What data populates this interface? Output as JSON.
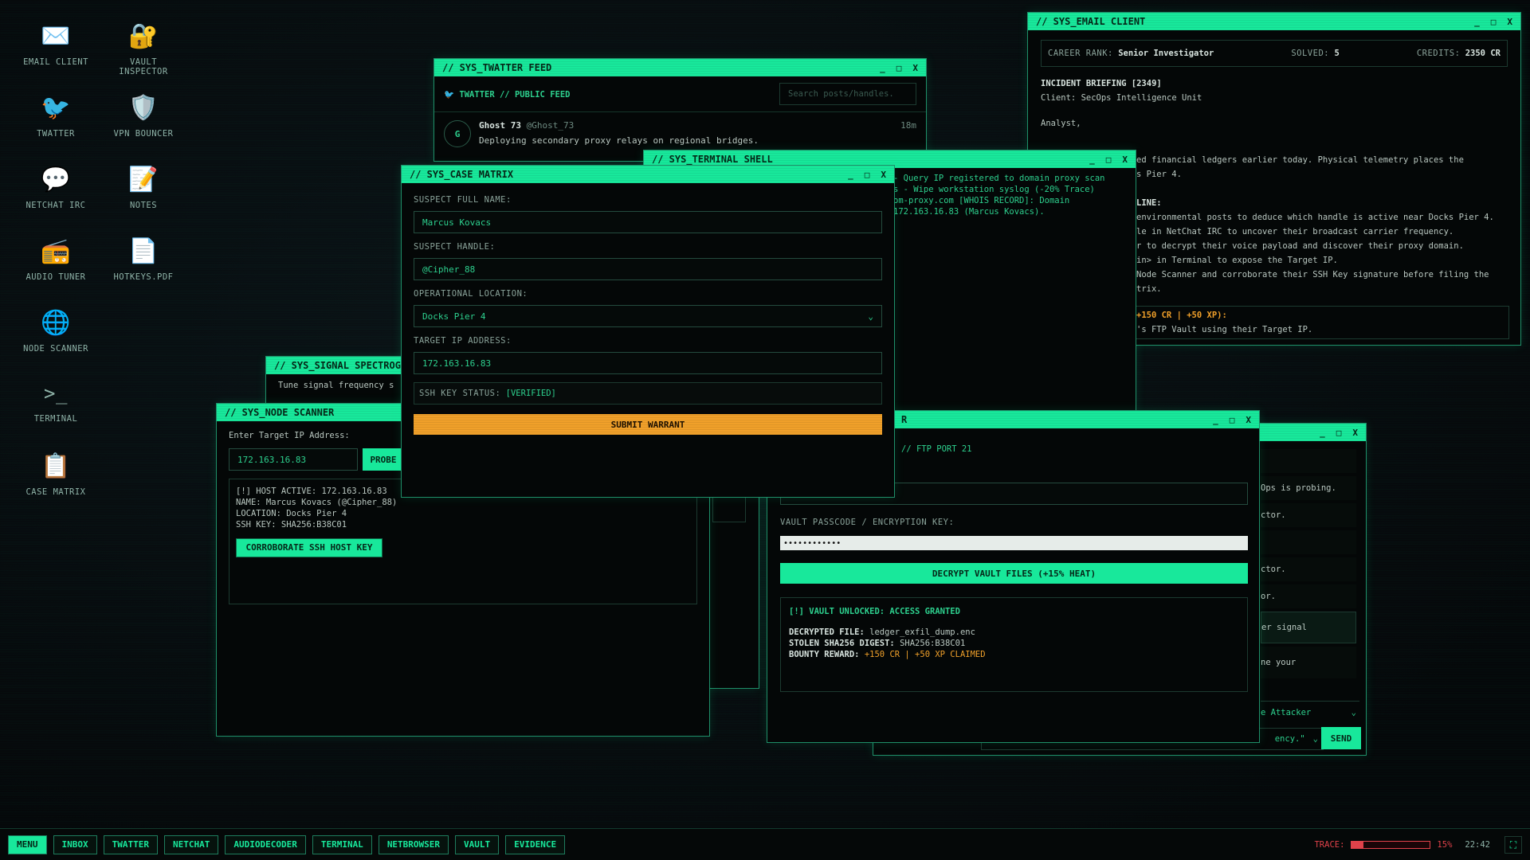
{
  "desktop": {
    "icons": [
      {
        "label": "EMAIL CLIENT",
        "glyph": "✉️"
      },
      {
        "label": "VAULT INSPECTOR",
        "glyph": "🔐"
      },
      {
        "label": "TWATTER",
        "glyph": "🐦"
      },
      {
        "label": "VPN BOUNCER",
        "glyph": "🛡️"
      },
      {
        "label": "NETCHAT IRC",
        "glyph": "💬"
      },
      {
        "label": "NOTES",
        "glyph": "📝"
      },
      {
        "label": "AUDIO TUNER",
        "glyph": "📻"
      },
      {
        "label": "HOTKEYS.PDF",
        "glyph": "📄"
      },
      {
        "label": "NODE SCANNER",
        "glyph": "🌐"
      },
      {
        "label": "TERMINAL",
        "glyph": ">_"
      },
      {
        "label": "CASE MATRIX",
        "glyph": "📋"
      }
    ]
  },
  "controls": {
    "min": "_",
    "max": "□",
    "close": "X"
  },
  "twatter": {
    "title": "// SYS_TWATTER FEED",
    "header": "TWATTER // PUBLIC FEED",
    "search_placeholder": "Search posts/handles.",
    "post": {
      "avatar": "G",
      "name": "Ghost 73",
      "handle": "@Ghost_73",
      "time": "18m",
      "text": "Deploying secondary proxy relays on regional bridges."
    }
  },
  "terminal": {
    "title": "// SYS_TERMINAL SHELL",
    "lines": [
      "- Query IP registered to domain proxy scan",
      "s - Wipe workstation syslog (-20% Trace)",
      "om-proxy.com [WHOIS RECORD]: Domain",
      "172.163.16.83 (Marcus Kovacs)."
    ]
  },
  "email": {
    "title": "// SYS_EMAIL CLIENT",
    "rank_label": "CAREER RANK:",
    "rank": "Senior Investigator",
    "solved_label": "SOLVED:",
    "solved": "5",
    "credits_label": "CREDITS:",
    "credits": "2350 CR",
    "briefing": "INCIDENT BRIEFING [2349]",
    "client": "Client: SecOps Intelligence Unit",
    "greeting": "Analyst,",
    "body": [
      "ed financial ledgers earlier today. Physical telemetry places the",
      "s Pier 4."
    ],
    "section": "LINE:",
    "steps": [
      "environmental posts to deduce which handle is active near Docks Pier 4.",
      "le in NetChat IRC to uncover their broadcast carrier frequency.",
      "r to decrypt their voice payload and discover their proxy domain.",
      "in> in Terminal to expose the Target IP.",
      "Node Scanner and corroborate their SSH Key signature before filing the",
      "trix."
    ],
    "reward": "+150 CR | +50 XP):",
    "reward_text": "'s FTP Vault using their Target IP."
  },
  "spectro": {
    "title": "// SYS_SIGNAL SPECTROG",
    "hint": "Tune signal frequency s"
  },
  "node": {
    "title": "// SYS_NODE SCANNER",
    "prompt": "Enter Target IP Address:",
    "ip": "172.163.16.83",
    "probe": "PROBE",
    "results": [
      "[!] HOST ACTIVE: 172.163.16.83",
      "NAME: Marcus Kovacs (@Cipher_88)",
      "LOCATION: Docks Pier 4",
      "SSH KEY: SHA256:B38C01"
    ],
    "corroborate": "CORROBORATE SSH HOST KEY"
  },
  "case": {
    "title": "// SYS_CASE MATRIX",
    "name_label": "SUSPECT FULL NAME:",
    "name": "Marcus Kovacs",
    "handle_label": "SUSPECT HANDLE:",
    "handle": "@Cipher_88",
    "loc_label": "OPERATIONAL LOCATION:",
    "loc": "Docks Pier 4",
    "ip_label": "TARGET IP ADDRESS:",
    "ip": "172.163.16.83",
    "ssh_label": "SSH KEY STATUS:",
    "ssh": "[VERIFIED]",
    "submit": "SUBMIT WARRANT"
  },
  "vault": {
    "title_tail": "R",
    "sub": "// FTP PORT 21",
    "pass_label": "VAULT PASSCODE / ENCRYPTION KEY:",
    "pass": "••••••••••••",
    "decrypt": "DECRYPT VAULT FILES (+15% HEAT)",
    "unlocked": "[!] VAULT UNLOCKED: ACCESS GRANTED",
    "file_label": "DECRYPTED FILE:",
    "file": "ledger_exfil_dump.enc",
    "digest_label": "STOLEN SHA256 DIGEST:",
    "digest": "SHA256:B38C01",
    "bounty_label": "BOUNTY REWARD:",
    "bounty": "+150 CR | +50 XP CLAIMED"
  },
  "irc": {
    "lines": [
      "Ops is probing.",
      "ctor.",
      "ctor.",
      "or.",
      "er signal",
      "ne your"
    ],
    "select1": "e Attacker",
    "select2": "ency.\"",
    "send": "SEND"
  },
  "taskbar": {
    "items": [
      "MENU",
      "INBOX",
      "TWATTER",
      "NETCHAT",
      "AUDIODECODER",
      "TERMINAL",
      "NETBROWSER",
      "VAULT",
      "EVIDENCE"
    ],
    "trace_label": "TRACE:",
    "trace_value": "15%",
    "trace_fraction": 0.15,
    "clock": "22:42"
  }
}
